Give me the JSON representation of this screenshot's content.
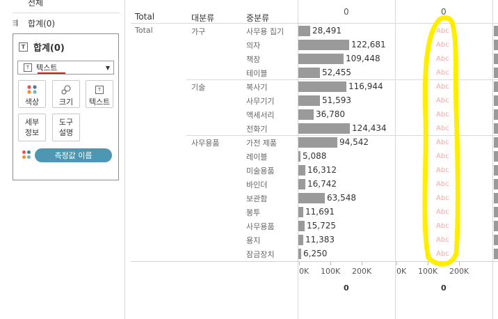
{
  "marks_panel": {
    "all_label": "전체",
    "sum_small_label": "합계(0)",
    "card_title": "합계(0)",
    "mark_type": "텍스트",
    "buttons": [
      "색상",
      "크기",
      "텍스트"
    ],
    "detail_label": "세부\n정보",
    "tooltip_label": "도구\n설명",
    "pill_label": "측정값 이름"
  },
  "view": {
    "col_headers": {
      "total": "Total",
      "category": "대분류",
      "subcategory": "중분류"
    },
    "pane_header_1": "0",
    "pane_header_2": "0",
    "row_total_label": "Total",
    "groups": [
      {
        "name": "가구",
        "items": [
          {
            "name": "사무용 집기",
            "value": 28491,
            "label": "28,491"
          },
          {
            "name": "의자",
            "value": 122681,
            "label": "122,681"
          },
          {
            "name": "책장",
            "value": 109448,
            "label": "109,448"
          },
          {
            "name": "테이블",
            "value": 52455,
            "label": "52,455"
          }
        ]
      },
      {
        "name": "기술",
        "items": [
          {
            "name": "복사기",
            "value": 116944,
            "label": "116,944"
          },
          {
            "name": "사무기기",
            "value": 51593,
            "label": "51,593"
          },
          {
            "name": "액세서리",
            "value": 36780,
            "label": "36,780"
          },
          {
            "name": "전화기",
            "value": 124434,
            "label": "124,434"
          }
        ]
      },
      {
        "name": "사무용품",
        "items": [
          {
            "name": "가전 제품",
            "value": 94542,
            "label": "94,542"
          },
          {
            "name": "레이블",
            "value": 5088,
            "label": "5,088"
          },
          {
            "name": "미술용품",
            "value": 16312,
            "label": "16,312"
          },
          {
            "name": "바인더",
            "value": 16742,
            "label": "16,742"
          },
          {
            "name": "보관함",
            "value": 63548,
            "label": "63,548"
          },
          {
            "name": "봉투",
            "value": 11691,
            "label": "11,691"
          },
          {
            "name": "사무용품",
            "value": 15725,
            "label": "15,725"
          },
          {
            "name": "용지",
            "value": 11383,
            "label": "11,383"
          },
          {
            "name": "잠금장치",
            "value": 6250,
            "label": "6,250"
          }
        ]
      }
    ],
    "abc_text": "Abc",
    "axis_1": {
      "ticks": [
        "0K",
        "100K",
        "200K"
      ],
      "title": "0"
    },
    "axis_2": {
      "ticks": [
        "0K",
        "100K",
        "200K"
      ],
      "title": "0"
    },
    "bar_max": 250000
  },
  "colors": {
    "bar": "#9a9a9a",
    "abc": "#f2a9a9",
    "highlight": "#ffee00",
    "pill": "#4e97b2",
    "underline": "#d62020"
  }
}
